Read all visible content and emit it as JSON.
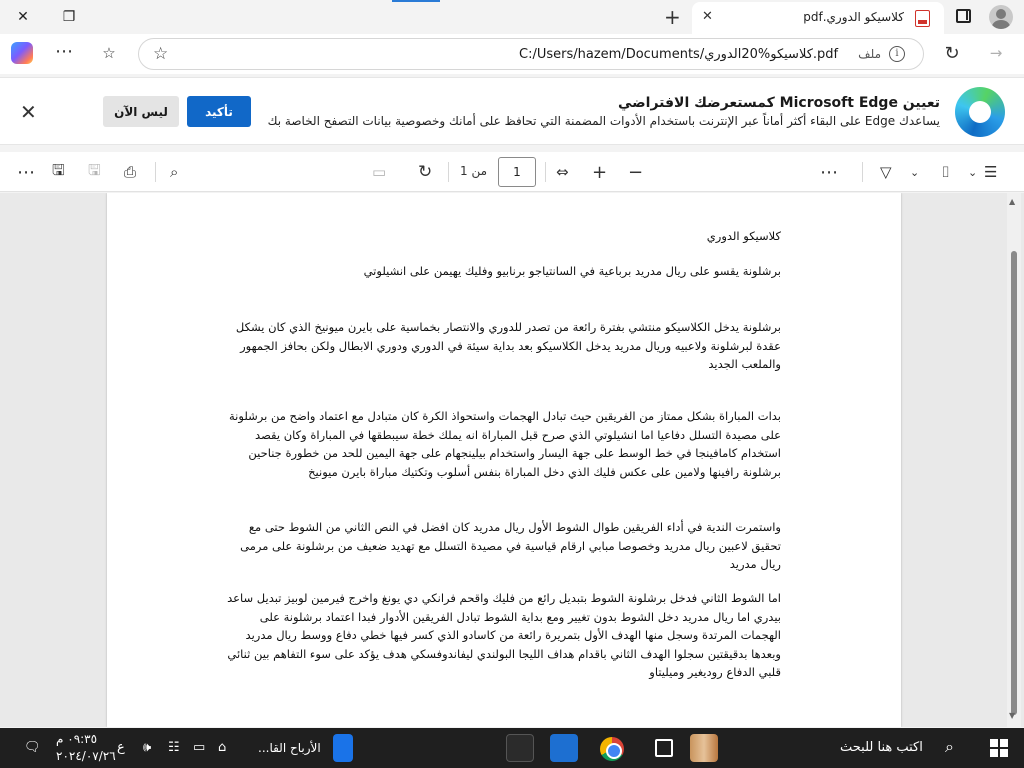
{
  "tab": {
    "title": "كلاسيكو الدوري.pdf"
  },
  "address": {
    "url": "C:/Users/hazem/Documents/كلاسيكو%20الدوري.pdf",
    "file_label": "ملف"
  },
  "banner": {
    "title": "تعيين Microsoft Edge كمستعرضك الافتراضي",
    "subtitle": "يساعدك Edge على البقاء أكثر أماناً عبر الإنترنت باستخدام الأدوات المضمنة التي تحافظ على أمانك وخصوصية بيانات التصفح الخاصة بك",
    "confirm": "تأكيد",
    "decline": "ليس الآن"
  },
  "toolbar": {
    "page_current": "1",
    "page_of": "من 1"
  },
  "document": {
    "title": "كلاسيكو الدوري",
    "paragraphs": [
      "برشلونة يقسو على ريال مدريد برباعية في السانتياجو برنابيو وفليك يهيمن على انشيلوتي",
      "برشلونة يدخل الكلاسيكو منتشي بفترة رائعة من تصدر للدوري والانتصار بخماسية على بايرن ميونيخ الذي كان يشكل عقدة لبرشلونة ولاعبيه وريال مدريد يدخل الكلاسيكو بعد بداية سيئة في الدوري ودوري الابطال ولكن بحافز الجمهور والملعب الجديد",
      "بدات المباراة بشكل ممتاز من الفريقين حيث تبادل الهجمات واستحواذ الكرة كان متبادل مع اعتماد واضح من برشلونة على مصيدة التسلل دفاعيا اما انشيلوتي الذي صرح قبل المباراة انه يملك خطة سيبطقها في المباراة وكان يقصد استخدام كامافينجا في خط الوسط على جهة اليسار واستخدام بيلينجهام على جهة اليمين للحد من خطورة جناحين برشلونة رافينها ولامين على عكس فليك الذي دخل المباراة بنفس أسلوب وتكتيك مباراة بايرن ميونيخ",
      "واستمرت الندية في أداء الفريقين طوال الشوط الأول ريال مدريد كان افضل في النص الثاني من الشوط حتى مع تحقيق لاعبين ريال مدريد وخصوصا مبابي ارقام قياسية في مصيدة التسلل مع تهديد ضعيف من برشلونة على مرمى ريال مدريد",
      "اما الشوط الثاني فدخل برشلونة الشوط بتبديل رائع من فليك واقحم فرانكي دي يونغ واخرج فيرمين لوبيز تبديل ساعد بيدري اما ريال مدريد دخل الشوط بدون تغيير ومع بداية الشوط تبادل الفريقين الأدوار فبدا اعتماد برشلونة على الهجمات المرتدة وسجل منها الهدف الأول بتمريرة رائعة من كاسادو الذي كسر فيها خطي دفاع ووسط ريال مدريد وبعدها بدقيقتين سجلوا الهدف الثاني باقدام هداف الليجا البولندي ليفاندوفسكي هدف يؤكد على سوء التفاهم بين ثنائي قلبي الدفاع روديغير وميليتاو"
    ]
  },
  "taskbar": {
    "search_placeholder": "اكتب هنا للبحث",
    "active_app": "الأرباح القا...",
    "time": "٠٩:٣٥ م",
    "date": "٢٠٢٤/٠٧/٢٦",
    "lang": "ع"
  },
  "colors": {
    "accent": "#1168c8",
    "taskbar": "#1f1f1f",
    "page": "#ffffff",
    "viewer_bg": "#e9e9e9"
  },
  "icons": [
    "close-icon",
    "restore-icon",
    "new-tab-icon",
    "tab-close-icon",
    "pdf-file-icon",
    "tab-actions-icon",
    "profile-icon",
    "copilot-icon",
    "more-icon",
    "favorites-icon",
    "star-icon",
    "info-icon",
    "refresh-icon",
    "forward-icon",
    "edge-logo-icon",
    "banner-close-icon",
    "save-as-icon",
    "save-icon",
    "print-icon",
    "find-icon",
    "page-view-icon",
    "rotate-icon",
    "fit-width-icon",
    "zoom-in-icon",
    "zoom-out-icon",
    "draw-icon",
    "highlight-icon",
    "erase-icon",
    "contents-icon",
    "windows-start-icon",
    "search-icon",
    "chrome-icon",
    "language-icon",
    "volume-icon",
    "network-icon",
    "notification-icon"
  ]
}
